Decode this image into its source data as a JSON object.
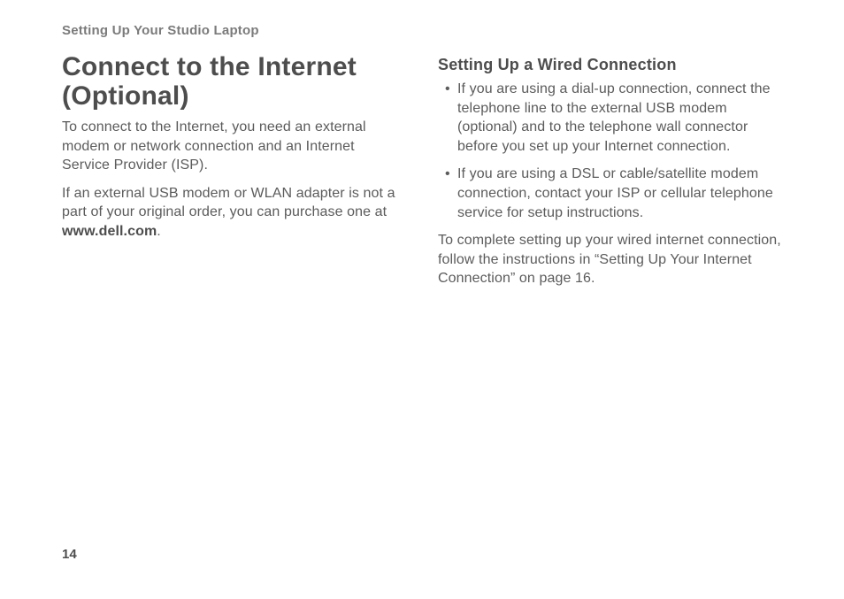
{
  "running_head": "Setting Up Your Studio Laptop",
  "page_number": "14",
  "left": {
    "title": "Connect to the Internet (Optional)",
    "para1": "To connect to the Internet, you need an external modem or network connection and an Internet Service Provider (ISP).",
    "para2_pre": "If an external USB modem or WLAN adapter is not a part of your original order, you can purchase one at ",
    "para2_bold": "www.dell.com",
    "para2_post": "."
  },
  "right": {
    "subhead": "Setting Up a Wired Connection",
    "bullets": [
      "If you are using a dial-up connection, connect the telephone line to the external USB modem (optional) and to the telephone wall connector before you set up your Internet connection.",
      "If you are using a DSL or cable/satellite modem connection, contact your ISP or cellular telephone service for setup instructions."
    ],
    "para_after": "To complete setting up your wired internet connection, follow the instructions in “Setting Up Your Internet Connection” on page 16."
  }
}
